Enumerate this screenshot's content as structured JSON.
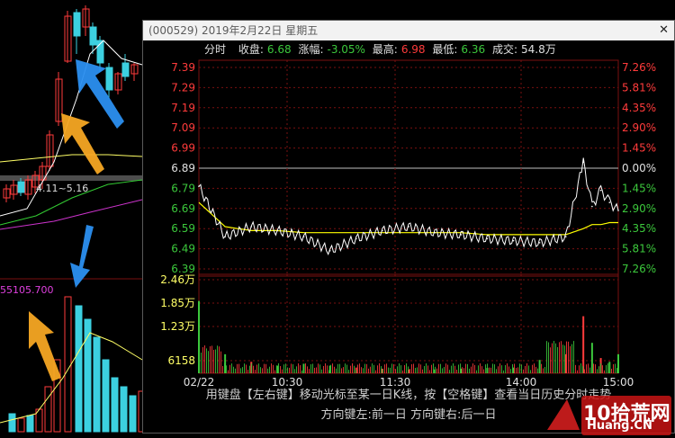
{
  "background": {
    "volume_label": "55105.700",
    "ma_label": "4.11~5.16"
  },
  "popup": {
    "title": "(000529) 2019年2月22日 星期五",
    "close_glyph": "✕",
    "stats": {
      "mode": "分时",
      "close_label": "收盘:",
      "close_value": "6.68",
      "change_label": "涨幅:",
      "change_value": "-3.05%",
      "high_label": "最高:",
      "high_value": "6.98",
      "low_label": "最低:",
      "low_value": "6.36",
      "volume_label": "成交:",
      "volume_value": "54.8万"
    },
    "footer_line1": "用键盘【左右键】移动光标至某一日K线，按【空格键】查看当日历史分时走势",
    "footer_line2": "方向键左:前一日    方向键右:后一日"
  },
  "watermark": {
    "text": "10拾荒网",
    "url": "Huang.CN"
  },
  "chart_data": {
    "type": "line",
    "title": "",
    "prev_close": 6.89,
    "price_ticks": [
      "7.39",
      "7.29",
      "7.19",
      "7.09",
      "6.99",
      "6.89",
      "6.79",
      "6.69",
      "6.59",
      "6.49",
      "6.39"
    ],
    "pct_ticks": [
      "7.26%",
      "5.81%",
      "4.35%",
      "2.90%",
      "1.45%",
      "0.00%",
      "1.45%",
      "2.90%",
      "4.35%",
      "5.81%",
      "7.26%"
    ],
    "volume_ticks": [
      "2.46万",
      "1.85万",
      "1.23万",
      "6158"
    ],
    "time_ticks": [
      "02/22",
      "10:30",
      "11:30",
      "14:00",
      "15:00"
    ],
    "ylim": [
      6.39,
      7.39
    ],
    "x": [
      "09:30",
      "09:45",
      "10:00",
      "10:15",
      "10:30",
      "10:45",
      "11:00",
      "11:15",
      "11:30",
      "13:15",
      "13:30",
      "13:45",
      "14:00",
      "14:15",
      "14:30",
      "14:40",
      "14:45",
      "14:50",
      "14:55",
      "15:00"
    ],
    "series": [
      {
        "values": [
          6.8,
          6.55,
          6.6,
          6.58,
          6.55,
          6.48,
          6.54,
          6.58,
          6.6,
          6.57,
          6.56,
          6.54,
          6.53,
          6.52,
          6.55,
          6.92,
          6.7,
          6.78,
          6.72,
          6.68
        ]
      },
      {
        "values": [
          6.72,
          6.6,
          6.58,
          6.58,
          6.57,
          6.57,
          6.57,
          6.57,
          6.57,
          6.57,
          6.57,
          6.56,
          6.56,
          6.56,
          6.56,
          6.59,
          6.61,
          6.61,
          6.62,
          6.62
        ]
      }
    ],
    "volume_series": [
      1.9,
      0.5,
      0.3,
      0.2,
      0.25,
      0.2,
      0.15,
      0.12,
      0.1,
      0.1,
      0.12,
      0.14,
      0.15,
      0.35,
      0.5,
      1.5,
      0.8,
      0.4,
      0.3,
      0.5
    ],
    "colors": {
      "up": "#ff3b3b",
      "down": "#3cc83c",
      "price_line": "#ffffff",
      "avg_line": "#ffff00",
      "grid": "#7a1010"
    }
  }
}
